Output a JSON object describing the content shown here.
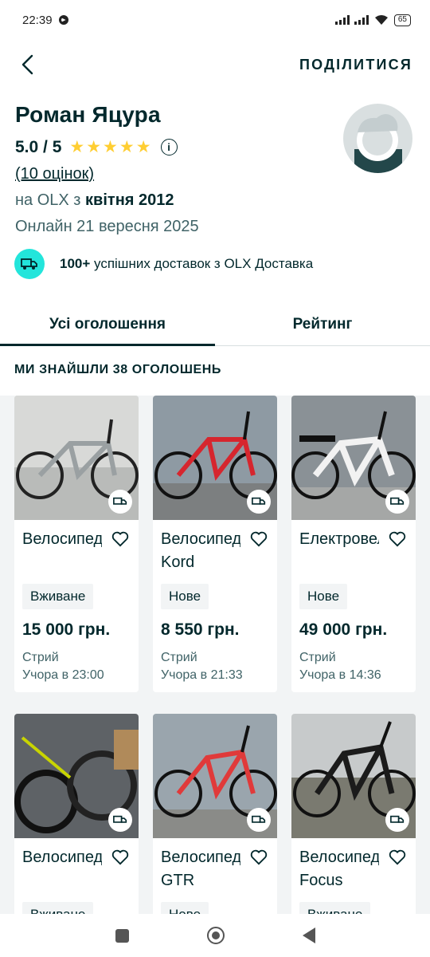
{
  "status": {
    "time": "22:39",
    "battery": "65"
  },
  "header": {
    "share_label": "ПОДІЛИТИСЯ"
  },
  "profile": {
    "name": "Роман Яцура",
    "score": "5.0 / 5",
    "stars": "★★★★★",
    "rating_value": 5,
    "reviews": "(10 оцінок)",
    "since_prefix": "на OLX з ",
    "since_date": "квітня 2012",
    "online": "Онлайн 21 вересня 2025"
  },
  "delivery": {
    "count": "100+",
    "text": " успішних доставок з OLX Доставка"
  },
  "tabs": [
    {
      "label": "Усі оголошення",
      "active": true
    },
    {
      "label": "Рейтинг",
      "active": false
    }
  ],
  "found_label": "МИ ЗНАЙШЛИ 38 ОГОЛОШЕНЬ",
  "listings": [
    {
      "title": "Велосипед",
      "condition": "Вживане",
      "price": "15 000 грн.",
      "city": "Стрий",
      "date": "Учора в 23:00"
    },
    {
      "title": "Велосипед Kord",
      "condition": "Нове",
      "price": "8 550 грн.",
      "city": "Стрий",
      "date": "Учора в 21:33"
    },
    {
      "title": "Електровелосипед",
      "condition": "Нове",
      "price": "49 000 грн.",
      "city": "Стрий",
      "date": "Учора в 14:36"
    },
    {
      "title": "Велосипед/",
      "condition": "Вживане",
      "price": "",
      "city": "",
      "date": ""
    },
    {
      "title": "Велосипед GTR",
      "condition": "Нове",
      "price": "",
      "city": "",
      "date": ""
    },
    {
      "title": "Велосипед Focus",
      "condition": "Вживане",
      "price": "",
      "city": "",
      "date": ""
    }
  ],
  "colors": {
    "brand_dark": "#02282c",
    "accent_teal": "#23e5db",
    "star": "#ffce32"
  }
}
